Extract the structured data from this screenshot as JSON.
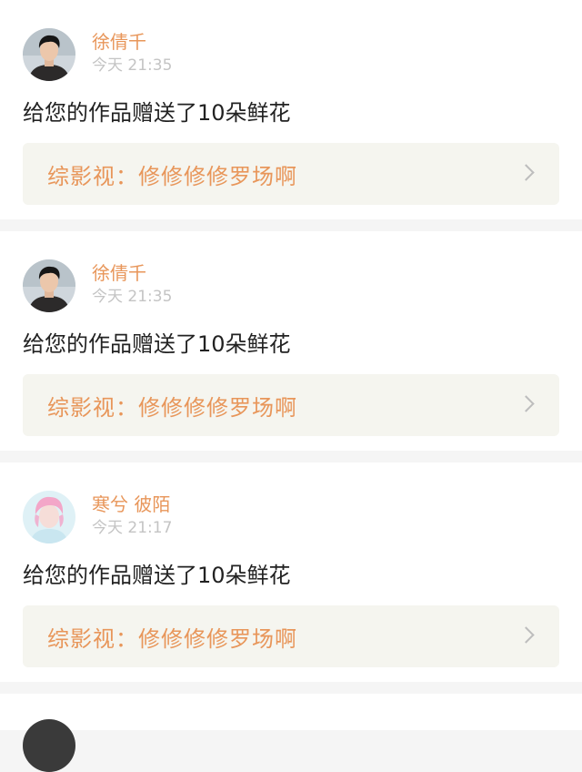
{
  "notifications": [
    {
      "username": "徐倩千",
      "time": "今天 21:35",
      "message": "给您的作品赠送了10朵鲜花",
      "work_title": "综影视：修修修修罗场啊",
      "avatar_icon": "portrait-male-avatar"
    },
    {
      "username": "徐倩千",
      "time": "今天 21:35",
      "message": "给您的作品赠送了10朵鲜花",
      "work_title": "综影视：修修修修罗场啊",
      "avatar_icon": "portrait-male-avatar"
    },
    {
      "username": "寒兮 彼陌",
      "time": "今天 21:17",
      "message": "给您的作品赠送了10朵鲜花",
      "work_title": "综影视：修修修修罗场啊",
      "avatar_icon": "portrait-pastel-avatar"
    }
  ],
  "colors": {
    "accent": "#e8965a",
    "time_gray": "#c4c4c4",
    "link_bg": "#f5f5ef",
    "page_bg": "#f5f5f5"
  }
}
